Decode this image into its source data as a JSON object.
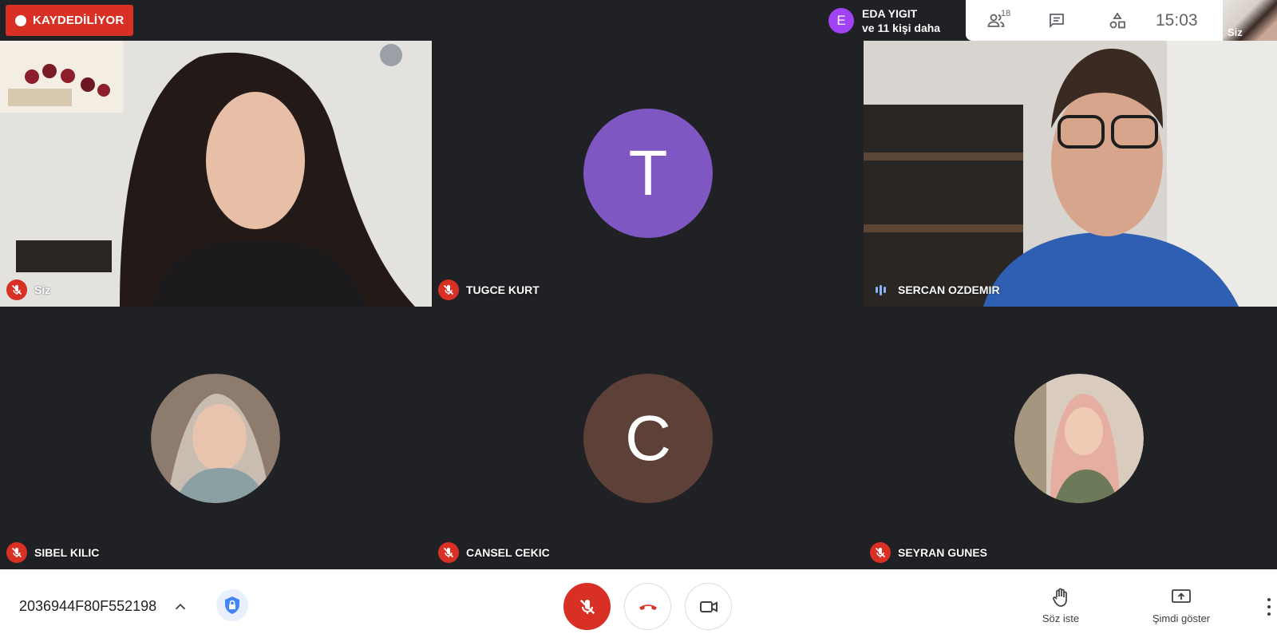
{
  "recording": {
    "label": "KAYDEDİLİYOR"
  },
  "presenter": {
    "initial": "E",
    "name": "EDA YIGIT",
    "others": "ve 11 kişi daha"
  },
  "topbar": {
    "participant_count": "18",
    "time": "15:03",
    "self_label": "Siz"
  },
  "tiles": [
    {
      "name": "Siz",
      "mic": "muted",
      "kind": "video"
    },
    {
      "name": "TUGCE KURT",
      "mic": "muted",
      "kind": "avatar",
      "initial": "T",
      "color": "#7e57c2"
    },
    {
      "name": "SERCAN OZDEMIR",
      "mic": "speaking",
      "kind": "video"
    },
    {
      "name": "SIBEL KILIC",
      "mic": "muted",
      "kind": "photo-avatar"
    },
    {
      "name": "CANSEL CEKIC",
      "mic": "muted",
      "kind": "avatar",
      "initial": "C",
      "color": "#5d4037"
    },
    {
      "name": "SEYRAN GUNES",
      "mic": "muted",
      "kind": "photo-avatar"
    }
  ],
  "bottombar": {
    "meeting_code": "2036944F80F552198",
    "raise_hand_label": "Söz iste",
    "present_label": "Şimdi göster"
  },
  "colors": {
    "accent_red": "#d93025",
    "bg_dark": "#202124",
    "avatar_purple": "#a142f4"
  },
  "icons": [
    "record-dot-icon",
    "people-icon",
    "chat-icon",
    "activities-icon",
    "mic-off-icon",
    "speaking-icon",
    "chevron-up-icon",
    "shield-lock-icon",
    "hang-up-icon",
    "camera-icon",
    "raise-hand-icon",
    "present-screen-icon",
    "more-vert-icon"
  ]
}
